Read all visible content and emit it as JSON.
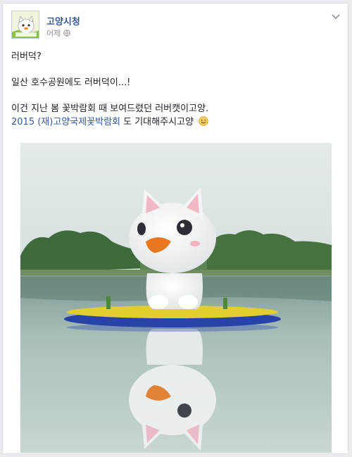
{
  "post": {
    "page_name": "고양시청",
    "timestamp": "어제",
    "line1": "러버덕?",
    "line2": "일산 호수공원에도 러버덕이...!",
    "line3": "이건 지난 봄 꽃박람회 때 보여드렸던 러버캣이고양.",
    "line4_link": "2015 (재)고양국제꽃박람회",
    "line4_rest": " 도 기대해주시고양",
    "emoji": "smile-emoji"
  },
  "icons": {
    "globe": "globe-icon",
    "chevron": "chevron-down-icon"
  },
  "colors": {
    "link": "#365899",
    "meta": "#90949c",
    "background": "#e9ebee"
  }
}
